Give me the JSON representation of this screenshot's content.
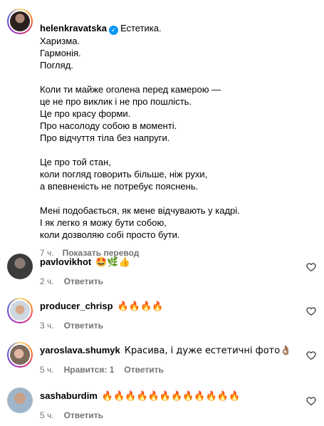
{
  "post": {
    "username": "helenkravatska",
    "caption_lines": [
      "Естетика.",
      "Харизма.",
      "Гармонія.",
      "Погляд."
    ],
    "paragraph_1": "Коли ти майже оголена перед камерою —\nце не про виклик і не про пошлість.\nЦе про красу форми.\nПро насолоду собою в моменті.\nПро відчуття тіла без напруги.",
    "paragraph_2": "Це про той стан,\nколи погляд говорить більше, ніж рухи,\nа впевненість не потребує пояснень.",
    "paragraph_3": "Мені подобається, як мене відчувають у кадрі.\nІ як легко я можу бути собою,\nколи дозволяю собі просто бути.",
    "time": "7 ч.",
    "translate_label": "Показать перевод"
  },
  "comments": [
    {
      "username": "pavlovikhot",
      "text": "🤩🌿👍",
      "time": "2 ч.",
      "reply_label": "Ответить"
    },
    {
      "username": "producer_chrisp",
      "text": "🔥🔥🔥🔥",
      "time": "3 ч.",
      "reply_label": "Ответить"
    },
    {
      "username": "yaroslava.shumyk",
      "text": "Красива, і дуже естетичні фото👌🏽",
      "time": "5 ч.",
      "likes_label": "Нравится: 1",
      "reply_label": "Ответить"
    },
    {
      "username": "sashaburdim",
      "text": "🔥🔥🔥🔥🔥🔥🔥🔥🔥🔥🔥🔥",
      "time": "5 ч.",
      "reply_label": "Ответить"
    }
  ]
}
